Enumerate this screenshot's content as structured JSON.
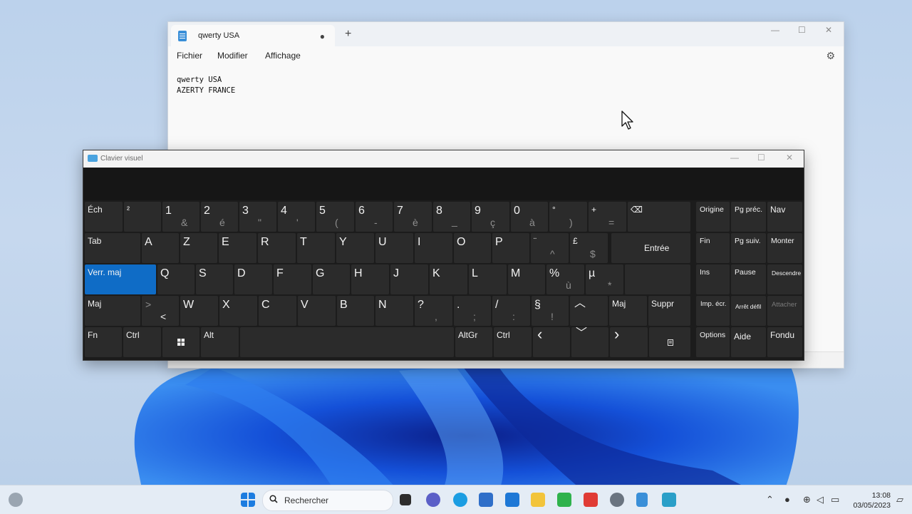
{
  "notepad": {
    "tab_title": "qwerty USA",
    "tab_dot": "●",
    "new_tab": "+",
    "menu": {
      "file": "Fichier",
      "edit": "Modifier",
      "view": "Affichage"
    },
    "lines": [
      "qwerty USA",
      "AZERTY FRANCE"
    ]
  },
  "osk": {
    "title": "Clavier visuel",
    "keys": {
      "esc": "Éch",
      "sup2": "²",
      "d1": "1",
      "d1s": "&",
      "d2": "2",
      "d2s": "é",
      "d3": "3",
      "d3s": "\"",
      "d4": "4",
      "d4s": "'",
      "d5": "5",
      "d5s": "(",
      "d6": "6",
      "d6s": "-",
      "d7": "7",
      "d7s": "è",
      "d8": "8",
      "d8s": "_",
      "d9": "9",
      "d9s": "ç",
      "d0": "0",
      "d0s": "à",
      "deg": "°",
      "degs": ")",
      "plus": "+",
      "pluss": "=",
      "backspace": "⌫",
      "home": "Origine",
      "pgup": "Pg préc.",
      "nav": "Nav",
      "tab": "Tab",
      "a": "A",
      "z": "Z",
      "e": "E",
      "r": "R",
      "t": "T",
      "y": "Y",
      "u": "U",
      "i": "I",
      "o": "O",
      "p": "P",
      "trema": "¨",
      "tremas": "^",
      "pound": "£",
      "pounds": "$",
      "enter": "Entrée",
      "end": "Fin",
      "pgdn": "Pg suiv.",
      "up_dock": "Monter",
      "caps": "Verr. maj",
      "q": "Q",
      "s": "S",
      "d": "D",
      "f": "F",
      "g": "G",
      "h": "H",
      "j": "J",
      "k": "K",
      "l": "L",
      "m": "M",
      "pct": "%",
      "pcts": "ù",
      "mu": "µ",
      "mus": "*",
      "ins": "Ins",
      "pause": "Pause",
      "down_dock": "Descendre",
      "shift_l": "Maj",
      "gt": ">",
      "lt": "<",
      "w": "W",
      "x": "X",
      "c": "C",
      "v": "V",
      "b": "B",
      "n": "N",
      "qm": "?",
      "qms": ",",
      "dot": ".",
      "dots": ";",
      "slash": "/",
      "slashs": ":",
      "sect": "§",
      "sects": "!",
      "arrow_up": "︿",
      "shift_r": "Maj",
      "del": "Suppr",
      "prtsc": "Imp. écr.",
      "scrlk": "Arrêt défil",
      "attach": "Attacher",
      "fn": "Fn",
      "ctrl_l": "Ctrl",
      "alt": "Alt",
      "altgr": "AltGr",
      "ctrl_r": "Ctrl",
      "arrow_left": "‹",
      "arrow_down": "﹀",
      "arrow_right": "›",
      "options": "Options",
      "help": "Aide",
      "fade": "Fondu"
    }
  },
  "taskbar": {
    "search_placeholder": "Rechercher",
    "time": "13:08",
    "date": "03/05/2023"
  },
  "colors": {
    "accent": "#0f6cc6",
    "key_bg": "#2b2b2b",
    "osk_bg": "#1c1c1c"
  }
}
